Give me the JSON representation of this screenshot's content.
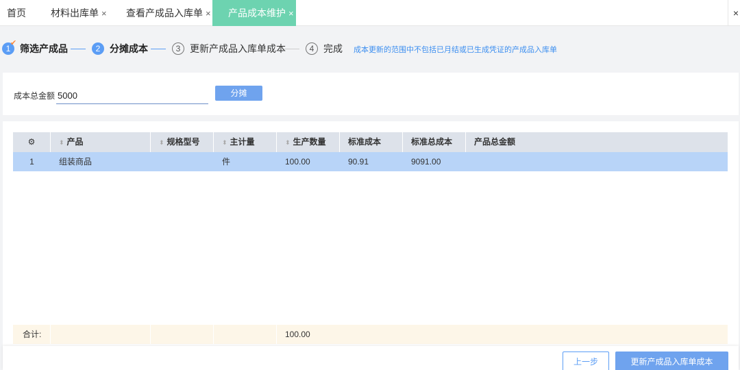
{
  "tabs": [
    {
      "label": "首页",
      "closable": false
    },
    {
      "label": "材料出库单",
      "closable": true
    },
    {
      "label": "查看产成品入库单",
      "closable": true
    },
    {
      "label": "产品成本维护",
      "closable": true,
      "active": true
    }
  ],
  "tab_close_glyph": "×",
  "steps": [
    {
      "number": "1",
      "label": "筛选产成品",
      "status": "done"
    },
    {
      "number": "2",
      "label": "分摊成本",
      "status": "current"
    },
    {
      "number": "3",
      "label": "更新产成品入库单成本",
      "status": "pending"
    },
    {
      "number": "4",
      "label": "完成",
      "status": "pending"
    }
  ],
  "steps_note": "成本更新的范围中不包括已月结或已生成凭证的产成品入库单",
  "form": {
    "total_cost_label": "成本总金额",
    "total_cost_value": "5000",
    "allocate_button": "分摊"
  },
  "table": {
    "columns": [
      "产品",
      "规格型号",
      "主计量",
      "生产数量",
      "标准成本",
      "标准总成本",
      "产品总金额"
    ],
    "rows": [
      {
        "index": "1",
        "product": "组装商品",
        "spec": "",
        "unit": "件",
        "quantity": "100.00",
        "std_cost": "90.91",
        "std_total": "9091.00",
        "total_amount": ""
      }
    ],
    "footer": {
      "label": "合计:",
      "quantity": "100.00"
    }
  },
  "buttons": {
    "prev": "上一步",
    "next": "更新产成品入库单成本"
  },
  "colors": {
    "active_tab": "#6dd3b0",
    "primary": "#5b9df5",
    "selected_row": "#b8d4f8",
    "footer_row": "#fdf6e8"
  }
}
